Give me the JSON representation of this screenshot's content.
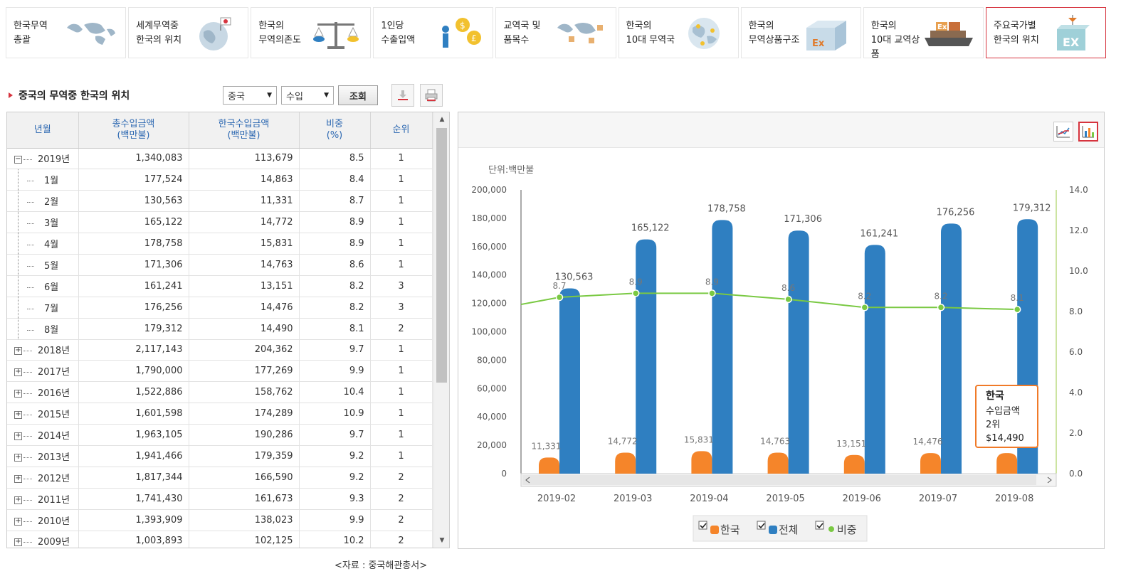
{
  "nav": [
    {
      "label": "한국무역\n총괄",
      "icon": "world-map-icon",
      "active": false
    },
    {
      "label": "세계무역중\n한국의 위치",
      "icon": "globe-flag-icon",
      "active": false
    },
    {
      "label": "한국의\n무역의존도",
      "icon": "scale-icon",
      "active": false
    },
    {
      "label": "1인당\n수출입액",
      "icon": "person-coins-icon",
      "active": false
    },
    {
      "label": "교역국 및\n품목수",
      "icon": "world-map-boxes-icon",
      "active": false
    },
    {
      "label": "한국의\n10대 무역국",
      "icon": "globe-icon",
      "active": false
    },
    {
      "label": "한국의\n무역상품구조",
      "icon": "box-ex-icon",
      "active": false
    },
    {
      "label": "한국의\n10대 교역상품",
      "icon": "ship-containers-icon",
      "active": false
    },
    {
      "label": "주요국가별\n한국의 위치",
      "icon": "crane-container-icon",
      "active": true
    }
  ],
  "section": {
    "title": "중국의 무역중 한국의 위치",
    "country": "중국",
    "flow": "수입",
    "search_label": "조회"
  },
  "table": {
    "headers": [
      "년월",
      "총수입금액\n(백만불)",
      "한국수입금액\n(백만불)",
      "비중\n(%)",
      "순위"
    ],
    "rows": [
      {
        "period": "2019년",
        "level": "year",
        "expanded": true,
        "total": "1,340,083",
        "korea": "113,679",
        "share": "8.5",
        "rank": "1"
      },
      {
        "period": "1월",
        "level": "month",
        "total": "177,524",
        "korea": "14,863",
        "share": "8.4",
        "rank": "1"
      },
      {
        "period": "2월",
        "level": "month",
        "total": "130,563",
        "korea": "11,331",
        "share": "8.7",
        "rank": "1"
      },
      {
        "period": "3월",
        "level": "month",
        "total": "165,122",
        "korea": "14,772",
        "share": "8.9",
        "rank": "1"
      },
      {
        "period": "4월",
        "level": "month",
        "total": "178,758",
        "korea": "15,831",
        "share": "8.9",
        "rank": "1"
      },
      {
        "period": "5월",
        "level": "month",
        "total": "171,306",
        "korea": "14,763",
        "share": "8.6",
        "rank": "1"
      },
      {
        "period": "6월",
        "level": "month",
        "total": "161,241",
        "korea": "13,151",
        "share": "8.2",
        "rank": "3"
      },
      {
        "period": "7월",
        "level": "month",
        "total": "176,256",
        "korea": "14,476",
        "share": "8.2",
        "rank": "3"
      },
      {
        "period": "8월",
        "level": "month",
        "total": "179,312",
        "korea": "14,490",
        "share": "8.1",
        "rank": "2"
      },
      {
        "period": "2018년",
        "level": "year",
        "total": "2,117,143",
        "korea": "204,362",
        "share": "9.7",
        "rank": "1"
      },
      {
        "period": "2017년",
        "level": "year",
        "total": "1,790,000",
        "korea": "177,269",
        "share": "9.9",
        "rank": "1"
      },
      {
        "period": "2016년",
        "level": "year",
        "total": "1,522,886",
        "korea": "158,762",
        "share": "10.4",
        "rank": "1"
      },
      {
        "period": "2015년",
        "level": "year",
        "total": "1,601,598",
        "korea": "174,289",
        "share": "10.9",
        "rank": "1"
      },
      {
        "period": "2014년",
        "level": "year",
        "total": "1,963,105",
        "korea": "190,286",
        "share": "9.7",
        "rank": "1"
      },
      {
        "period": "2013년",
        "level": "year",
        "total": "1,941,466",
        "korea": "179,359",
        "share": "9.2",
        "rank": "1"
      },
      {
        "period": "2012년",
        "level": "year",
        "total": "1,817,344",
        "korea": "166,590",
        "share": "9.2",
        "rank": "2"
      },
      {
        "period": "2011년",
        "level": "year",
        "total": "1,741,430",
        "korea": "161,673",
        "share": "9.3",
        "rank": "2"
      },
      {
        "period": "2010년",
        "level": "year",
        "total": "1,393,909",
        "korea": "138,023",
        "share": "9.9",
        "rank": "2"
      },
      {
        "period": "2009년",
        "level": "year",
        "total": "1,003,893",
        "korea": "102,125",
        "share": "10.2",
        "rank": "2"
      }
    ]
  },
  "source_note": "<자료 : 중국해관총서>",
  "chart_data": {
    "type": "bar",
    "unit_label": "단위:백만불",
    "categories": [
      "2019-02",
      "2019-03",
      "2019-04",
      "2019-05",
      "2019-06",
      "2019-07",
      "2019-08"
    ],
    "series": [
      {
        "name": "한국",
        "type": "bar",
        "color": "#f5852a",
        "values": [
          11331,
          14772,
          15831,
          14763,
          13151,
          14476,
          14490
        ]
      },
      {
        "name": "전체",
        "type": "bar",
        "color": "#2f7fc1",
        "values": [
          130563,
          165122,
          178758,
          171306,
          161241,
          176256,
          179312
        ]
      },
      {
        "name": "비중",
        "type": "line",
        "color": "#7ac943",
        "axis": "right",
        "values": [
          8.7,
          8.9,
          8.9,
          8.6,
          8.2,
          8.2,
          8.1
        ]
      }
    ],
    "left_axis": {
      "min": 0,
      "max": 200000,
      "ticks": [
        "0",
        "20,000",
        "40,000",
        "60,000",
        "80,000",
        "100,000",
        "120,000",
        "140,000",
        "160,000",
        "180,000",
        "200,000"
      ]
    },
    "right_axis": {
      "min": 0,
      "max": 14,
      "ticks": [
        "0.0",
        "2.0",
        "4.0",
        "6.0",
        "8.0",
        "10.0",
        "12.0",
        "14.0"
      ]
    },
    "total_labels": [
      "130,563",
      "165,122",
      "178,758",
      "171,306",
      "161,241",
      "176,256",
      "179,312"
    ],
    "korea_labels": [
      "11,331",
      "14,772",
      "15,831",
      "14,763",
      "13,151",
      "14,476",
      "14,490"
    ],
    "share_labels": [
      "8.7",
      "8.9",
      "8.9",
      "8.6",
      "8.2",
      "8.2",
      "8.1"
    ],
    "legend": [
      {
        "name": "한국",
        "color": "#f5852a",
        "checked": true
      },
      {
        "name": "전체",
        "color": "#2f7fc1",
        "checked": true
      },
      {
        "name": "비중",
        "color": "#7ac943",
        "checked": true
      }
    ],
    "tooltip": {
      "title": "한국",
      "line1": "수입금액",
      "line2": "2위",
      "line3": "$14,490"
    }
  }
}
